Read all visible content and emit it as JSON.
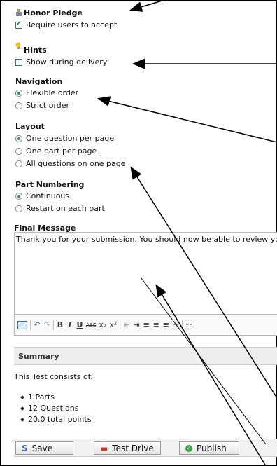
{
  "honor_pledge": {
    "title": "Honor Pledge",
    "checkbox_label": "Require users to accept",
    "checked": true
  },
  "hints": {
    "title": "Hints",
    "checkbox_label": "Show during delivery",
    "checked": false
  },
  "navigation": {
    "title": "Navigation",
    "options": [
      "Flexible order",
      "Strict order"
    ],
    "selected": "Flexible order"
  },
  "layout": {
    "title": "Layout",
    "options": [
      "One question per page",
      "One part per page",
      "All questions on one page"
    ],
    "selected": "One question per page"
  },
  "part_numbering": {
    "title": "Part Numbering",
    "options": [
      "Continuous",
      "Restart on each part"
    ],
    "selected": "Continuous"
  },
  "final_message": {
    "title": "Final Message",
    "text": "Thank you for your submission. You should now be able to review your"
  },
  "editor_toolbar": {
    "bold": "B",
    "italic": "I",
    "underline": "U",
    "strike": "ABC",
    "subscript": "x₂",
    "superscript": "x²"
  },
  "summary": {
    "title": "Summary",
    "intro": "This Test consists of:",
    "items": [
      "1 Parts",
      "12 Questions",
      "20.0 total points"
    ]
  },
  "buttons": {
    "save": "Save",
    "test_drive": "Test Drive",
    "publish": "Publish"
  },
  "colors": {
    "radio_selected": "#2a9a2a",
    "hint_bulb": "#f2c500",
    "arrow": "#000000"
  }
}
